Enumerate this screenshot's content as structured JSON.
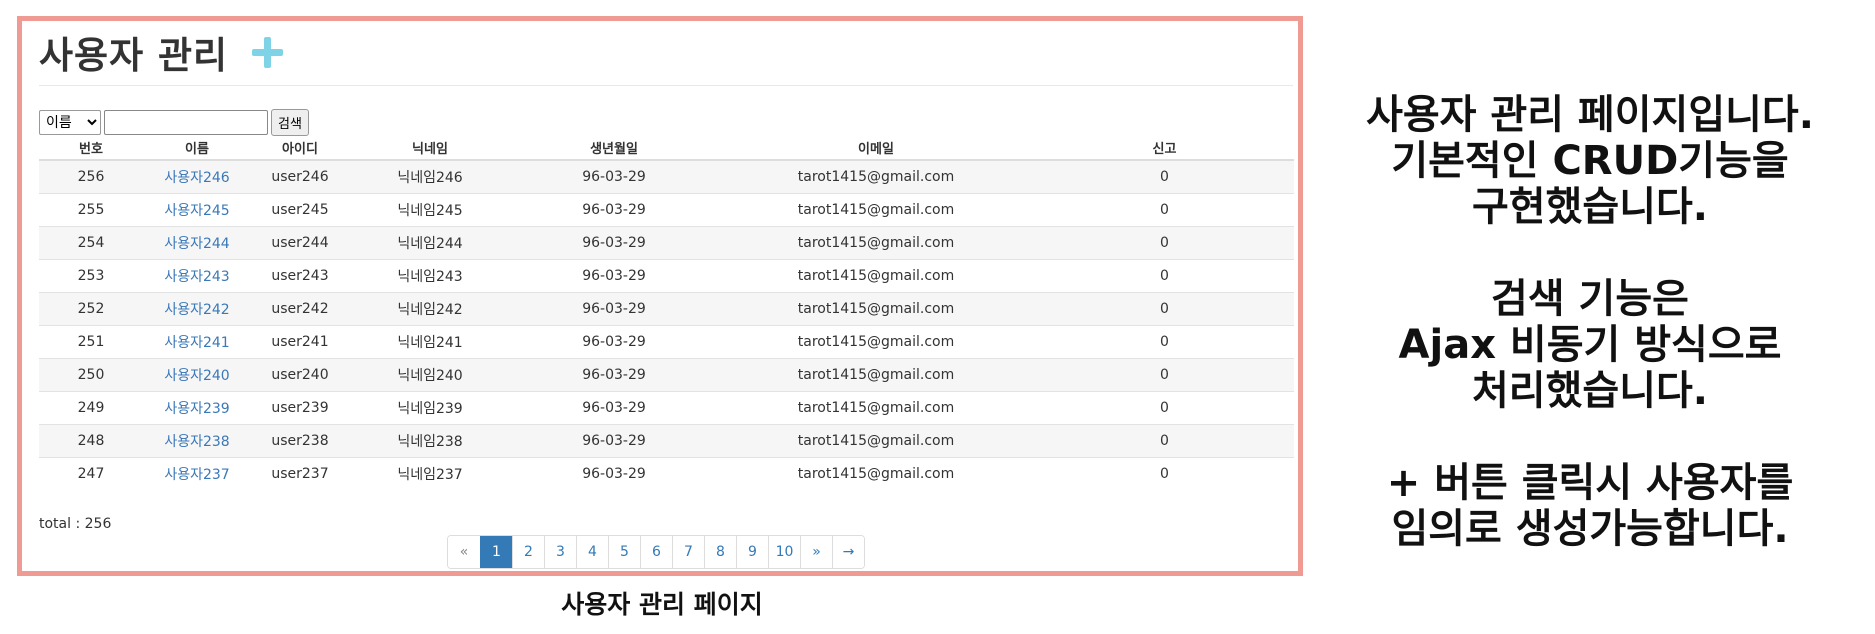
{
  "header": {
    "title": "사용자 관리",
    "add_icon": "plus-icon",
    "accent_color": "#7fd3e6"
  },
  "search": {
    "select_value": "이름",
    "input_value": "",
    "button_label": "검색"
  },
  "table": {
    "headers": [
      "번호",
      "이름",
      "아이디",
      "닉네임",
      "생년월일",
      "이메일",
      "신고"
    ],
    "rows": [
      [
        "256",
        "사용자246",
        "user246",
        "닉네임246",
        "96-03-29",
        "tarot1415@gmail.com",
        "0"
      ],
      [
        "255",
        "사용자245",
        "user245",
        "닉네임245",
        "96-03-29",
        "tarot1415@gmail.com",
        "0"
      ],
      [
        "254",
        "사용자244",
        "user244",
        "닉네임244",
        "96-03-29",
        "tarot1415@gmail.com",
        "0"
      ],
      [
        "253",
        "사용자243",
        "user243",
        "닉네임243",
        "96-03-29",
        "tarot1415@gmail.com",
        "0"
      ],
      [
        "252",
        "사용자242",
        "user242",
        "닉네임242",
        "96-03-29",
        "tarot1415@gmail.com",
        "0"
      ],
      [
        "251",
        "사용자241",
        "user241",
        "닉네임241",
        "96-03-29",
        "tarot1415@gmail.com",
        "0"
      ],
      [
        "250",
        "사용자240",
        "user240",
        "닉네임240",
        "96-03-29",
        "tarot1415@gmail.com",
        "0"
      ],
      [
        "249",
        "사용자239",
        "user239",
        "닉네임239",
        "96-03-29",
        "tarot1415@gmail.com",
        "0"
      ],
      [
        "248",
        "사용자238",
        "user238",
        "닉네임238",
        "96-03-29",
        "tarot1415@gmail.com",
        "0"
      ],
      [
        "247",
        "사용자237",
        "user237",
        "닉네임237",
        "96-03-29",
        "tarot1415@gmail.com",
        "0"
      ]
    ]
  },
  "total": {
    "label": "total : 256"
  },
  "pagination": {
    "items": [
      "«",
      "1",
      "2",
      "3",
      "4",
      "5",
      "6",
      "7",
      "8",
      "9",
      "10",
      "»",
      "→"
    ],
    "active": "1",
    "active_color": "#337ab7"
  },
  "caption": "사용자 관리 페이지",
  "description": {
    "paragraphs": [
      [
        "사용자 관리 페이지입니다.",
        "기본적인 CRUD기능을",
        "구현했습니다."
      ],
      [
        "검색 기능은",
        "Ajax 비동기 방식으로",
        "처리했습니다."
      ],
      [
        "+ 버튼 클릭시 사용자를",
        "임의로 생성가능합니다."
      ]
    ]
  },
  "frame_border_color": "#ef9a93"
}
